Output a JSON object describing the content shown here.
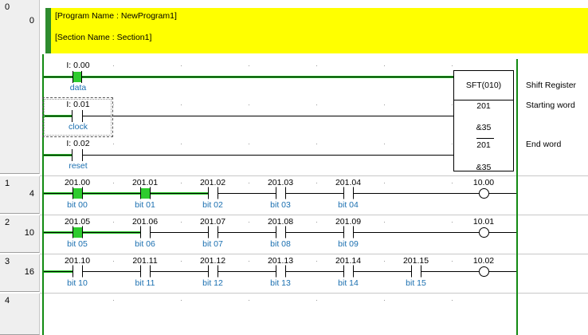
{
  "rungs": [
    {
      "num": "0",
      "step": "0"
    },
    {
      "num": "1",
      "step": "4"
    },
    {
      "num": "2",
      "step": "10"
    },
    {
      "num": "3",
      "step": "16"
    },
    {
      "num": "4",
      "step": ""
    }
  ],
  "comment": {
    "program": "[Program Name : NewProgram1]",
    "section": "[Section Name : Section1]"
  },
  "rung0": {
    "contacts": [
      {
        "address": "I: 0.00",
        "comment": "data",
        "on": true
      },
      {
        "address": "I: 0.01",
        "comment": "clock",
        "on": false
      },
      {
        "address": "I: 0.02",
        "comment": "reset",
        "on": false
      }
    ],
    "instruction": {
      "name": "SFT(010)",
      "operands": [
        "201",
        "&35",
        "201",
        "&35"
      ],
      "descriptions": [
        "Shift Register",
        "Starting word",
        "End word"
      ]
    }
  },
  "rung1": {
    "contacts": [
      {
        "address": "201.00",
        "comment": "bit 00",
        "on": true
      },
      {
        "address": "201.01",
        "comment": "bit 01",
        "on": true
      },
      {
        "address": "201.02",
        "comment": "bit 02",
        "on": false
      },
      {
        "address": "201.03",
        "comment": "bit 03",
        "on": false
      },
      {
        "address": "201.04",
        "comment": "bit 04",
        "on": false
      }
    ],
    "coil": {
      "address": "10.00"
    }
  },
  "rung2": {
    "contacts": [
      {
        "address": "201.05",
        "comment": "bit 05",
        "on": true
      },
      {
        "address": "201.06",
        "comment": "bit 06",
        "on": false
      },
      {
        "address": "201.07",
        "comment": "bit 07",
        "on": false
      },
      {
        "address": "201.08",
        "comment": "bit 08",
        "on": false
      },
      {
        "address": "201.09",
        "comment": "bit 09",
        "on": false
      }
    ],
    "coil": {
      "address": "10.01"
    }
  },
  "rung3": {
    "contacts": [
      {
        "address": "201.10",
        "comment": "bit 10",
        "on": false
      },
      {
        "address": "201.11",
        "comment": "bit 11",
        "on": false
      },
      {
        "address": "201.12",
        "comment": "bit 12",
        "on": false
      },
      {
        "address": "201.13",
        "comment": "bit 13",
        "on": false
      },
      {
        "address": "201.14",
        "comment": "bit 14",
        "on": false
      },
      {
        "address": "201.15",
        "comment": "bit 15",
        "on": false
      }
    ],
    "coil": {
      "address": "10.02"
    }
  },
  "colors": {
    "power_flow": "#2ecc2e",
    "rail": "#128a12",
    "comment_bg": "#ffff00",
    "comment_text": "#1a6fb0"
  }
}
